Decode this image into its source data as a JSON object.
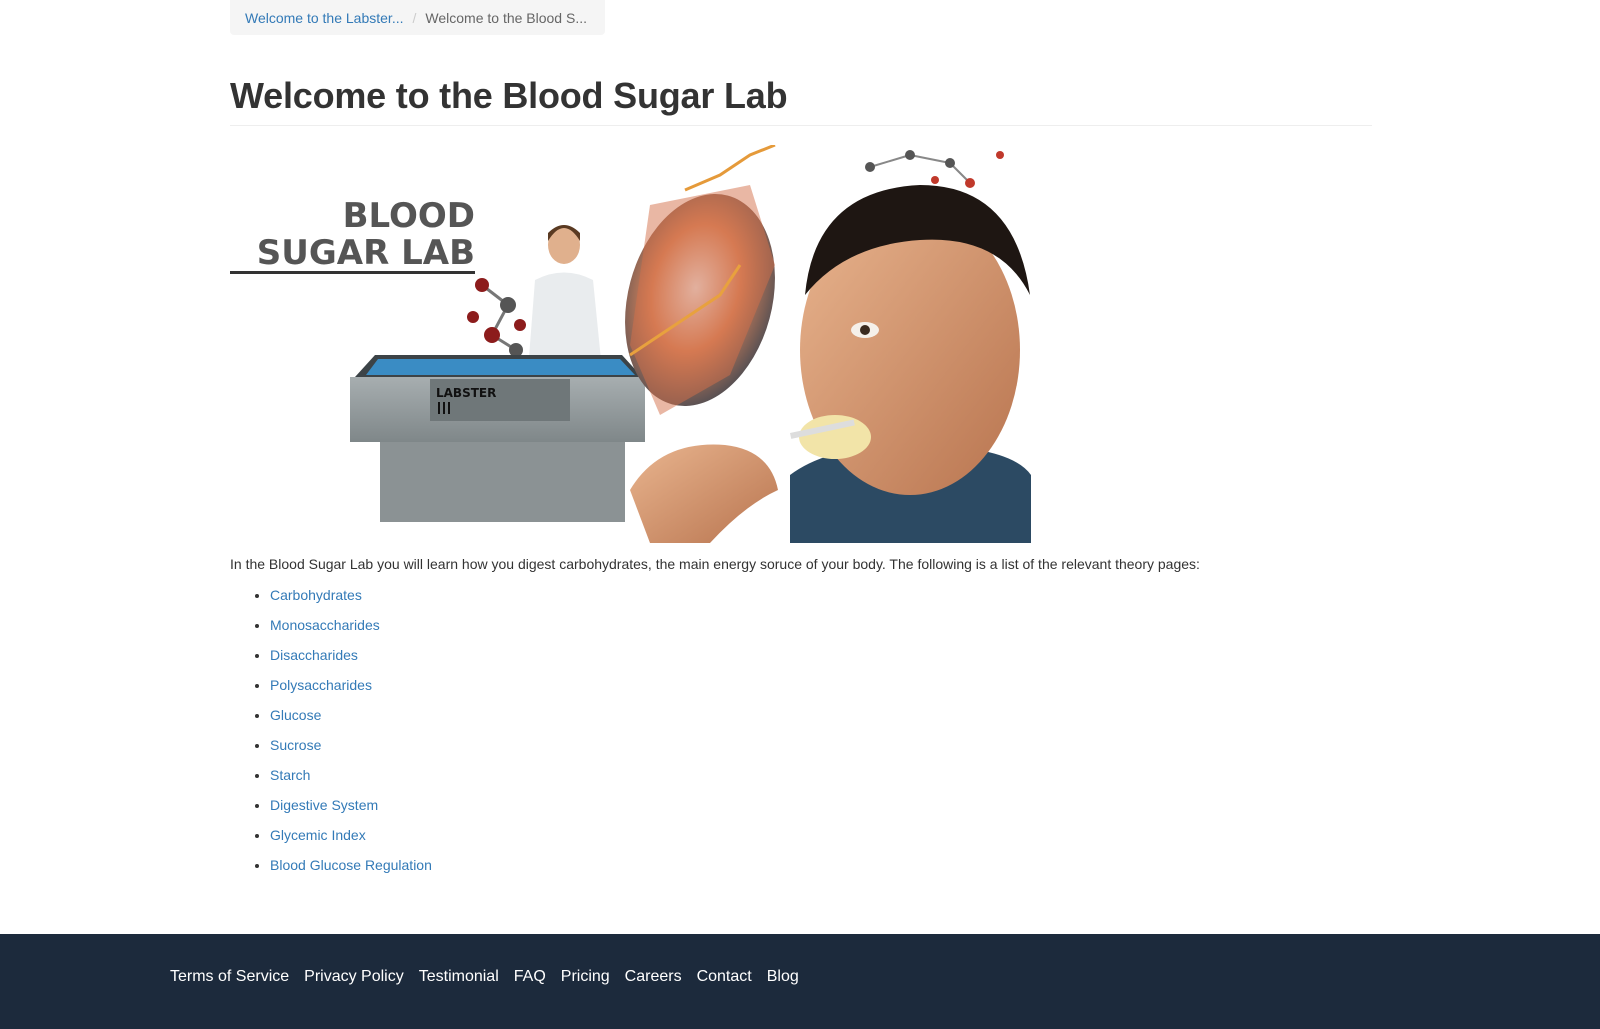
{
  "breadcrumb": {
    "items": [
      {
        "label": "Welcome to the Labster..."
      },
      {
        "label": "Welcome to the Blood S..."
      }
    ],
    "separator": "/"
  },
  "page": {
    "title": "Welcome to the Blood Sugar Lab",
    "hero": {
      "logo_line1": "BLOOD",
      "logo_line2": "SUGAR LAB",
      "equipment_label": "LABSTER"
    },
    "intro": "In the Blood Sugar Lab you will learn how you digest carbohydrates, the main energy soruce of your body. The following is a list of the relevant theory pages:",
    "theory_links": [
      {
        "label": "Carbohydrates"
      },
      {
        "label": "Monosaccharides"
      },
      {
        "label": "Disaccharides"
      },
      {
        "label": "Polysaccharides"
      },
      {
        "label": "Glucose"
      },
      {
        "label": "Sucrose"
      },
      {
        "label": "Starch"
      },
      {
        "label": "Digestive System"
      },
      {
        "label": "Glycemic Index"
      },
      {
        "label": "Blood Glucose Regulation"
      }
    ]
  },
  "footer": {
    "links": [
      {
        "label": "Terms of Service"
      },
      {
        "label": "Privacy Policy"
      },
      {
        "label": "Testimonial"
      },
      {
        "label": "FAQ"
      },
      {
        "label": "Pricing"
      },
      {
        "label": "Careers"
      },
      {
        "label": "Contact"
      },
      {
        "label": "Blog"
      }
    ]
  },
  "colors": {
    "link": "#337ab7",
    "footer_bg": "#1c2a3c",
    "breadcrumb_bg": "#f5f5f5"
  }
}
